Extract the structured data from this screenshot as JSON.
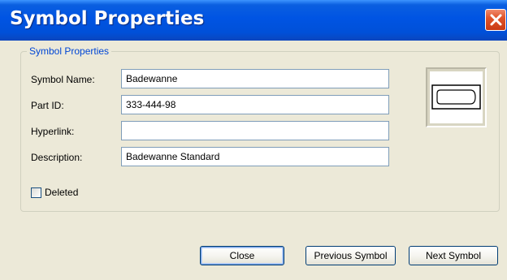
{
  "window": {
    "title": "Symbol Properties"
  },
  "group": {
    "legend": "Symbol Properties"
  },
  "fields": [
    {
      "label": "Symbol Name:",
      "value": "Badewanne"
    },
    {
      "label": "Part ID:",
      "value": "333-444-98"
    },
    {
      "label": "Hyperlink:",
      "value": ""
    },
    {
      "label": "Description:",
      "value": "Badewanne Standard"
    }
  ],
  "deleted": {
    "label": "Deleted",
    "checked": false
  },
  "preview": {
    "icon": "bathtub-symbol-icon"
  },
  "buttons": {
    "close": "Close",
    "previous": "Previous Symbol",
    "next": "Next Symbol"
  },
  "colors": {
    "titlebar": "#0054e3",
    "legend": "#0046d5",
    "dialog_bg": "#ece9d8",
    "close_button": "#e0542a"
  }
}
